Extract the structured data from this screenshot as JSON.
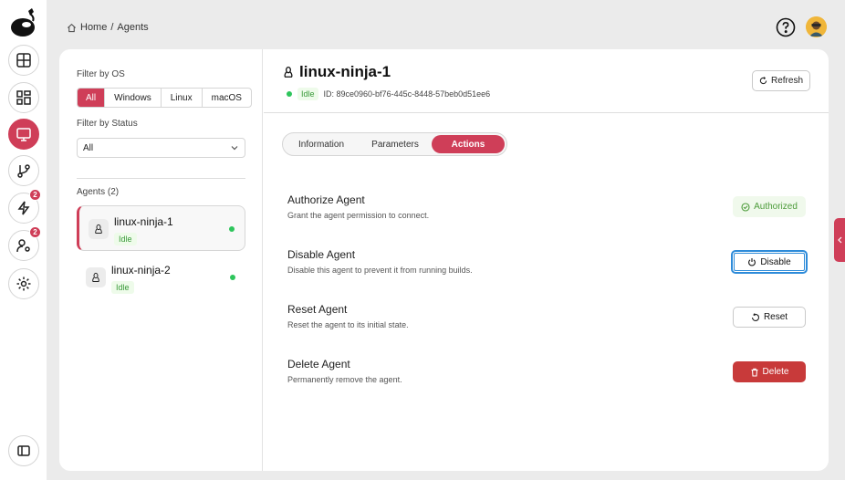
{
  "breadcrumb": {
    "home": "Home",
    "sep": "/",
    "current": "Agents"
  },
  "rail": {
    "items": [
      {
        "name": "dashboard",
        "icon": "layout-icon"
      },
      {
        "name": "grid",
        "icon": "grid-icon"
      },
      {
        "name": "agents",
        "icon": "monitor-icon",
        "active": true
      },
      {
        "name": "branches",
        "icon": "git-branch-icon"
      },
      {
        "name": "builds",
        "icon": "lightning-icon",
        "badge": "2"
      },
      {
        "name": "users",
        "icon": "user-settings-icon",
        "badge": "2"
      },
      {
        "name": "settings",
        "icon": "gear-icon"
      }
    ]
  },
  "filters": {
    "os_label": "Filter by OS",
    "os_options": [
      "All",
      "Windows",
      "Linux",
      "macOS"
    ],
    "os_selected": "All",
    "status_label": "Filter by Status",
    "status_value": "All"
  },
  "agents": {
    "heading": "Agents (2)",
    "list": [
      {
        "name": "linux-ninja-1",
        "status": "Idle"
      },
      {
        "name": "linux-ninja-2",
        "status": "Idle"
      }
    ]
  },
  "detail": {
    "name": "linux-ninja-1",
    "status": "Idle",
    "id": "ID: 89ce0960-bf76-445c-8448-57beb0d51ee6",
    "refresh_label": "Refresh",
    "tabs": [
      "Information",
      "Parameters",
      "Actions"
    ],
    "active_tab": "Actions",
    "actions": [
      {
        "title": "Authorize Agent",
        "desc": "Grant the agent permission to connect.",
        "button": "Authorized"
      },
      {
        "title": "Disable Agent",
        "desc": "Disable this agent to prevent it from running builds.",
        "button": "Disable"
      },
      {
        "title": "Reset Agent",
        "desc": "Reset the agent to its initial state.",
        "button": "Reset"
      },
      {
        "title": "Delete Agent",
        "desc": "Permanently remove the agent.",
        "button": "Delete"
      }
    ]
  },
  "colors": {
    "accent": "#cf3e58",
    "success": "#2ec55c",
    "danger": "#c83a3a",
    "focus": "#2d8bd9"
  }
}
